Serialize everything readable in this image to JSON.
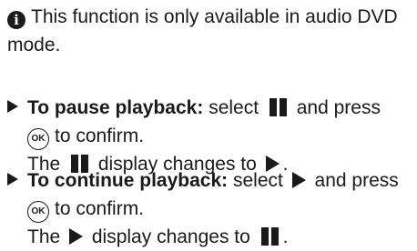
{
  "note": {
    "icon": "info-icon",
    "text": "This function is only available in audio DVD mode."
  },
  "steps": [
    {
      "label": "To pause playback:",
      "text_before_symbol": "select",
      "symbol": "pause-icon",
      "text_after_symbol": "and press",
      "button": "OK",
      "confirm_text": "to confirm.",
      "result_before": "The",
      "result_symbol": "pause-icon",
      "result_middle": "display changes to",
      "result_target_symbol": "play-icon",
      "result_end": "."
    },
    {
      "label": "To continue playback:",
      "text_before_symbol": "select",
      "symbol": "play-icon",
      "text_after_symbol": "and press",
      "button": "OK",
      "confirm_text": "to confirm.",
      "result_before": "The",
      "result_symbol": "play-icon",
      "result_middle": "display changes to",
      "result_target_symbol": "pause-icon",
      "result_end": "."
    }
  ]
}
